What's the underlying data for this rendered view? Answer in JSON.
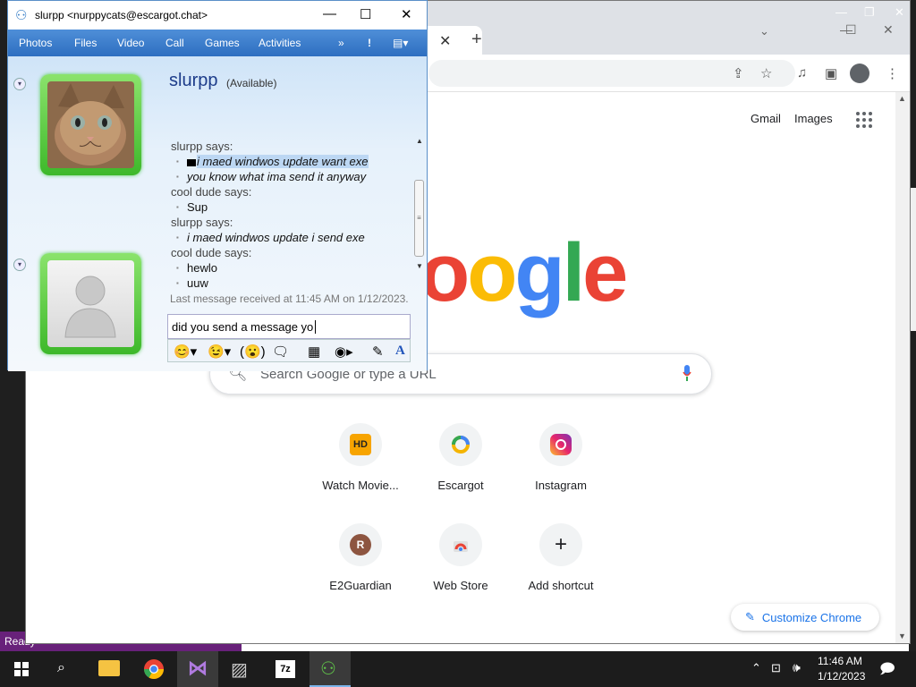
{
  "desktop": {
    "status_text": "Ready"
  },
  "chrome": {
    "header_links": {
      "gmail": "Gmail",
      "images": "Images"
    },
    "search_placeholder": "Search Google or type a URL",
    "logo_text": "oogle",
    "shortcuts": [
      {
        "label": "Watch Movie...",
        "icon": "HD"
      },
      {
        "label": "Escargot",
        "icon": "escargot-icon"
      },
      {
        "label": "Instagram",
        "icon": "instagram-icon"
      },
      {
        "label": "E2Guardian",
        "icon": "R"
      },
      {
        "label": "Web Store",
        "icon": "webstore-icon"
      },
      {
        "label": "Add shortcut",
        "icon": "+"
      }
    ],
    "customize_label": "Customize Chrome",
    "colors": {
      "blue": "#4285f4",
      "red": "#ea4335",
      "yellow": "#fbbc05",
      "green": "#34a853"
    }
  },
  "messenger": {
    "title": "slurpp <nurppycats@escargot.chat>",
    "menu": [
      "Photos",
      "Files",
      "Video",
      "Call",
      "Games",
      "Activities"
    ],
    "contact": {
      "name": "slurpp",
      "status": "(Available)"
    },
    "conversation": [
      {
        "sender": "slurpp says:",
        "messages": [
          "i maed windwos update want exe",
          "you know what ima send it anyway"
        ]
      },
      {
        "sender": "cool dude says:",
        "messages": [
          "Sup"
        ]
      },
      {
        "sender": "slurpp says:",
        "messages": [
          "i maed windwos update i send exe"
        ]
      },
      {
        "sender": "cool dude says:",
        "messages": [
          "hewlo",
          "uuw"
        ]
      }
    ],
    "last_message": "Last message received at 11:45 AM on 1/12/2023.",
    "input_text": "did you send a message yo",
    "accent": "#2d6ec0"
  },
  "taskbar": {
    "time": "11:46 AM",
    "date": "1/12/2023",
    "apps": [
      "file-explorer-icon",
      "chrome-icon",
      "visual-studio-icon",
      "photos-icon",
      "7zip-icon",
      "messenger-icon"
    ]
  }
}
